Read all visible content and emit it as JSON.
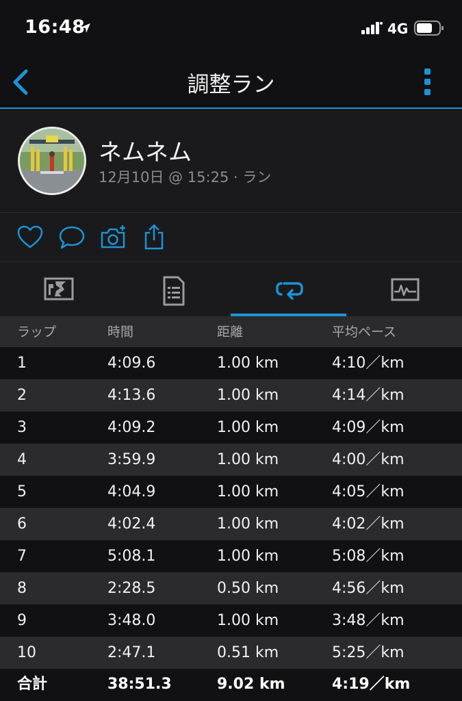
{
  "status_bar": {
    "time": "16:48",
    "network": "4G",
    "icons": [
      "location-arrow-icon",
      "signal-icon",
      "battery-icon"
    ]
  },
  "nav": {
    "title": "調整ラン",
    "back_icon": "chevron-left-icon",
    "more_icon": "vertical-ellipsis-icon"
  },
  "profile": {
    "name": "ネムネム",
    "meta": "12月10日 @ 15:25 · ラン"
  },
  "actions": [
    "heart-icon",
    "comment-icon",
    "camera-add-icon",
    "share-icon"
  ],
  "tabs": [
    {
      "icon": "map-icon",
      "active": false
    },
    {
      "icon": "stats-document-icon",
      "active": false
    },
    {
      "icon": "laps-icon",
      "active": true
    },
    {
      "icon": "chart-icon",
      "active": false
    }
  ],
  "colors": {
    "accent": "#1d93d6",
    "background": "#111113",
    "panel": "#1a1a1c",
    "stripe": "#2b2b2e"
  },
  "laps": {
    "headers": [
      "ラップ",
      "時間",
      "距離",
      "平均ペース"
    ],
    "rows": [
      [
        "1",
        "4:09.6",
        "1.00 km",
        "4:10／km"
      ],
      [
        "2",
        "4:13.6",
        "1.00 km",
        "4:14／km"
      ],
      [
        "3",
        "4:09.2",
        "1.00 km",
        "4:09／km"
      ],
      [
        "4",
        "3:59.9",
        "1.00 km",
        "4:00／km"
      ],
      [
        "5",
        "4:04.9",
        "1.00 km",
        "4:05／km"
      ],
      [
        "6",
        "4:02.4",
        "1.00 km",
        "4:02／km"
      ],
      [
        "7",
        "5:08.1",
        "1.00 km",
        "5:08／km"
      ],
      [
        "8",
        "2:28.5",
        "0.50 km",
        "4:56／km"
      ],
      [
        "9",
        "3:48.0",
        "1.00 km",
        "3:48／km"
      ],
      [
        "10",
        "2:47.1",
        "0.51 km",
        "5:25／km"
      ]
    ],
    "total": [
      "合計",
      "38:51.3",
      "9.02 km",
      "4:19／km"
    ]
  }
}
